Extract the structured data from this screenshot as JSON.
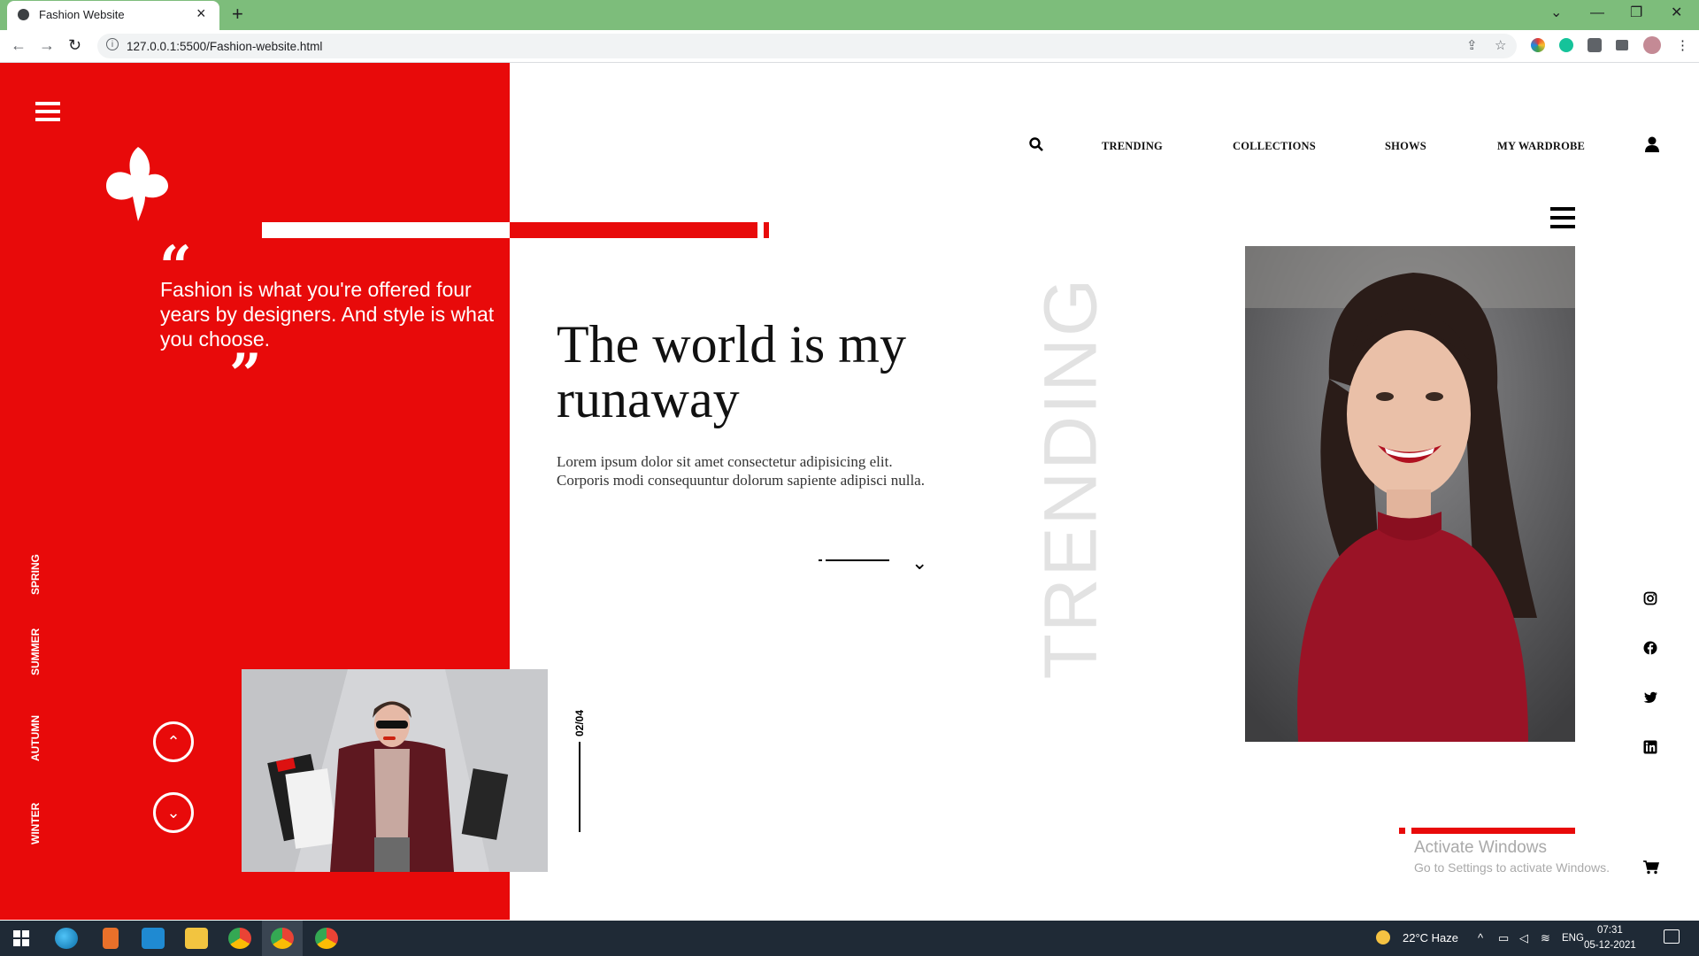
{
  "browser": {
    "tab_title": "Fashion Website",
    "tab_close": "×",
    "new_tab": "+",
    "url": "127.0.0.1:5500/Fashion-website.html",
    "back": "←",
    "forward": "→",
    "reload": "↻",
    "minimize": "—",
    "restore": "❐",
    "close": "✕",
    "tab_menu": "⌄",
    "share": "⇪",
    "star": "☆",
    "menu": "⋮"
  },
  "colors": {
    "accent": "#e80a0a",
    "tabbar": "#7dbd7b"
  },
  "sidebar": {
    "quote_open": "“",
    "quote_text": "Fashion is what you're offered four years by designers. And style is what you choose.",
    "quote_close": "”",
    "seasons": [
      "SPRING",
      "SUMMER",
      "AUTUMN",
      "WINTER"
    ],
    "up_icon": "⌃",
    "down_icon": "⌄"
  },
  "nav": {
    "items": [
      "TRENDING",
      "COLLECTIONS",
      "SHOWS",
      "MY WARDROBE"
    ]
  },
  "hero": {
    "title": "The world is my runaway",
    "text": "Lorem ipsum dolor sit amet consectetur adipisicing elit. Corporis modi consequuntur dolorum sapiente adipisci nulla.",
    "chevron": "⌄",
    "page_counter": "02/04"
  },
  "trending_label": "TRENDING",
  "watermark": {
    "title": "Activate Windows",
    "subtitle": "Go to Settings to activate Windows."
  },
  "taskbar": {
    "weather": "22°C  Haze",
    "language": "ENG",
    "time": "07:31",
    "date": "05-12-2021"
  }
}
